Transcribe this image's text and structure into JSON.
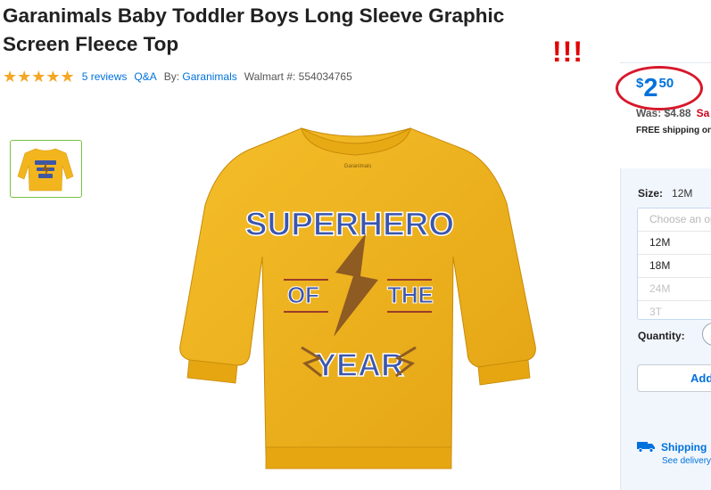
{
  "product": {
    "title": "Garanimals Baby Toddler Boys Long Sleeve Graphic Screen Fleece Top",
    "rating_stars": "★★★★★",
    "reviews": "5 reviews",
    "qa": "Q&A",
    "by_label": "By:",
    "brand": "Garanimals",
    "walmart_label": "Walmart #:",
    "walmart_number": "554034765"
  },
  "annotation": {
    "exclaim": "!!!"
  },
  "image": {
    "shirt_color": "#f2b51e",
    "graphic_line1": "SUPERHERO",
    "graphic_line2a": "OF",
    "graphic_line2b": "THE",
    "graphic_line3": "YEAR",
    "shirt_tag": "Garanimals"
  },
  "pricing": {
    "currency": "$",
    "dollars": "2",
    "cents": "50",
    "was": "Was: $4.88",
    "save": "Sa",
    "free_shipping": "FREE shipping on"
  },
  "options": {
    "size_label": "Size:",
    "size_value": "12M",
    "placeholder": "Choose an op",
    "sizes": [
      {
        "label": "12M",
        "available": true
      },
      {
        "label": "18M",
        "available": true
      },
      {
        "label": "24M",
        "available": false
      },
      {
        "label": "3T",
        "available": false
      }
    ],
    "quantity_label": "Quantity:",
    "add_button": "Add"
  },
  "shipping": {
    "label": "Shipping",
    "sub": "See delivery"
  },
  "colors": {
    "accent": "#0071dc",
    "annotation": "#d8182b",
    "stars": "#f5a623"
  }
}
